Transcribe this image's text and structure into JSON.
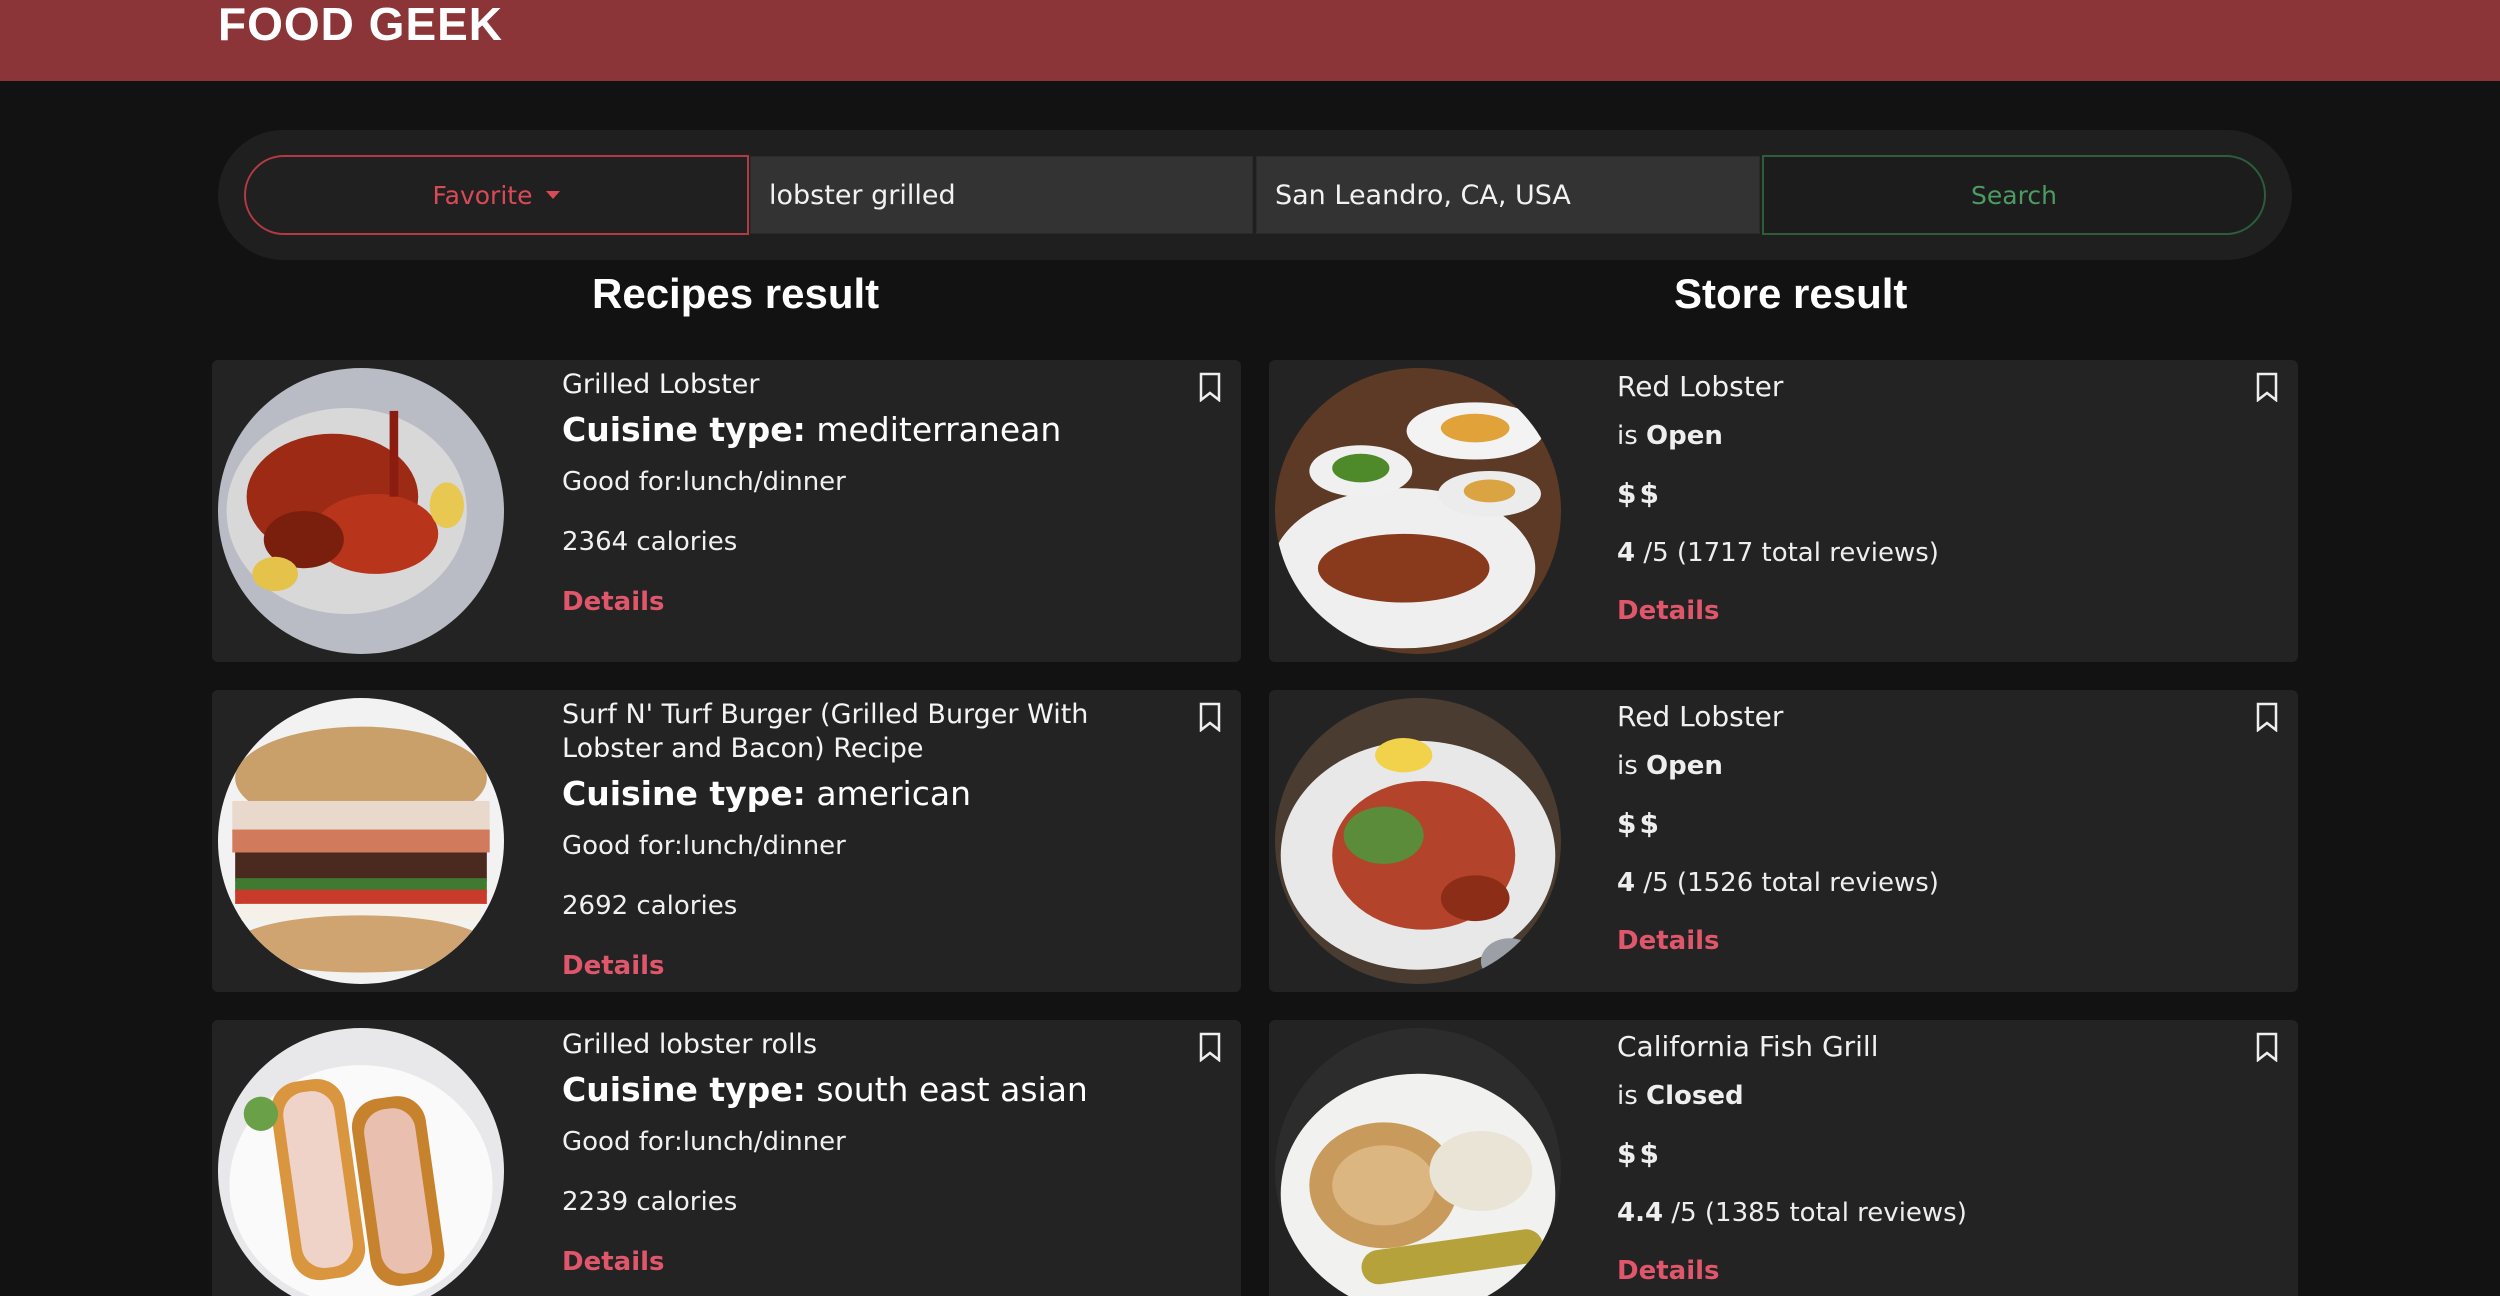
{
  "app": {
    "title": "FOOD GEEK"
  },
  "search": {
    "favorite_label": "Favorite",
    "query": "lobster grilled",
    "location": "San Leandro, CA, USA",
    "search_label": "Search"
  },
  "sections": {
    "recipes": "Recipes result",
    "stores": "Store result"
  },
  "recipes": [
    {
      "title": "Grilled Lobster",
      "cuisine_label": "Cuisine type:",
      "cuisine": " mediterranean",
      "good_for": "Good for:lunch/dinner",
      "calories": "2364 calories",
      "details": "Details"
    },
    {
      "title": "Surf N' Turf Burger (Grilled Burger With Lobster and Bacon) Recipe",
      "cuisine_label": "Cuisine type:",
      "cuisine": " american",
      "good_for": "Good for:lunch/dinner",
      "calories": "2692 calories",
      "details": "Details"
    },
    {
      "title": "Grilled lobster rolls",
      "cuisine_label": "Cuisine type:",
      "cuisine": " south east asian",
      "good_for": "Good for:lunch/dinner",
      "calories": "2239 calories",
      "details": "Details"
    }
  ],
  "stores": [
    {
      "name": "Red Lobster",
      "is": "is ",
      "status": "Open",
      "price": "$$",
      "rating": "4",
      "rating_rest": " /5 (1717 total reviews)",
      "details": "Details"
    },
    {
      "name": "Red Lobster",
      "is": "is ",
      "status": "Open",
      "price": "$$",
      "rating": "4",
      "rating_rest": " /5 (1526 total reviews)",
      "details": "Details"
    },
    {
      "name": "California Fish Grill",
      "is": "is ",
      "status": "Closed",
      "price": "$$",
      "rating": "4.4",
      "rating_rest": " /5 (1385 total reviews)",
      "details": "Details"
    }
  ],
  "colors": {
    "header": "#8b3538",
    "accent": "#e0566b",
    "search_green": "#4d9b63",
    "card": "#232323",
    "background": "#121212"
  }
}
